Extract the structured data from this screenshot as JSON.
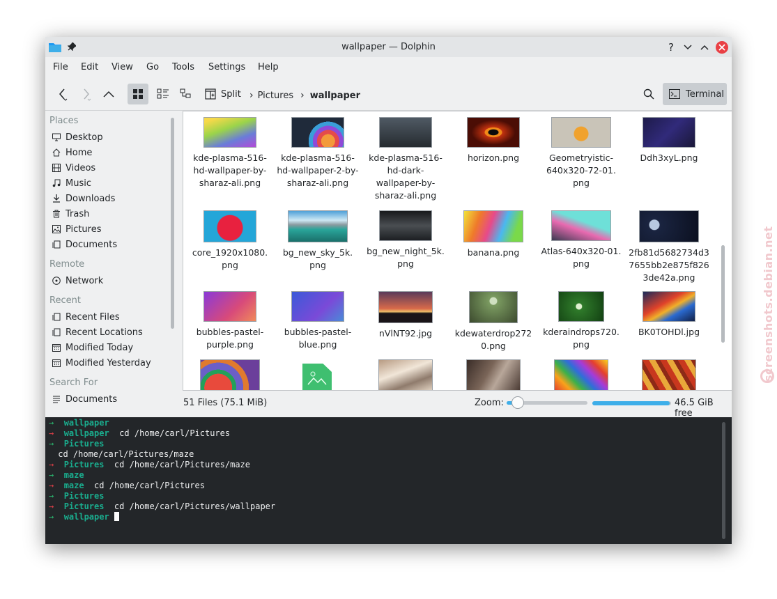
{
  "window": {
    "title": "wallpaper — Dolphin",
    "help_glyph": "?",
    "minimize_glyph": "⌄",
    "maximize_glyph": "⌃",
    "close_glyph": "✕"
  },
  "menubar": {
    "items": [
      "File",
      "Edit",
      "View",
      "Go",
      "Tools",
      "Settings",
      "Help"
    ]
  },
  "toolbar": {
    "split_label": "Split",
    "breadcrumb": [
      "Pictures",
      "wallpaper"
    ],
    "terminal_label": "Terminal"
  },
  "sidebar": {
    "sections": [
      {
        "title": "Places",
        "items": [
          {
            "label": "Desktop",
            "icon": "desktop-icon"
          },
          {
            "label": "Home",
            "icon": "home-icon"
          },
          {
            "label": "Videos",
            "icon": "videos-icon"
          },
          {
            "label": "Music",
            "icon": "music-icon"
          },
          {
            "label": "Downloads",
            "icon": "downloads-icon"
          },
          {
            "label": "Trash",
            "icon": "trash-icon"
          },
          {
            "label": "Pictures",
            "icon": "pictures-icon"
          },
          {
            "label": "Documents",
            "icon": "documents-icon"
          }
        ]
      },
      {
        "title": "Remote",
        "items": [
          {
            "label": "Network",
            "icon": "network-icon"
          }
        ]
      },
      {
        "title": "Recent",
        "items": [
          {
            "label": "Recent Files",
            "icon": "recent-files-icon"
          },
          {
            "label": "Recent Locations",
            "icon": "recent-locations-icon"
          },
          {
            "label": "Modified Today",
            "icon": "calendar-icon"
          },
          {
            "label": "Modified Yesterday",
            "icon": "calendar-icon"
          }
        ]
      },
      {
        "title": "Search For",
        "items": [
          {
            "label": "Documents",
            "icon": "documents-search-icon"
          }
        ]
      }
    ]
  },
  "files": [
    {
      "lines": [
        "kde-plasma-516-",
        "hd-wallpaper-by-",
        "sharaz-ali.png"
      ]
    },
    {
      "lines": [
        "kde-plasma-516-",
        "hd-wallpaper-2-by-",
        "sharaz-ali.png"
      ]
    },
    {
      "lines": [
        "kde-plasma-516-",
        "hd-dark-",
        "wallpaper-by-",
        "sharaz-ali.png"
      ]
    },
    {
      "lines": [
        "horizon.png"
      ]
    },
    {
      "lines": [
        "Geometryistic-",
        "640x320-72-01.",
        "png"
      ]
    },
    {
      "lines": [
        "Ddh3xyL.png"
      ]
    },
    {
      "lines": [
        "core_1920x1080.",
        "png"
      ]
    },
    {
      "lines": [
        "bg_new_sky_5k.",
        "png"
      ]
    },
    {
      "lines": [
        "bg_new_night_5k.",
        "png"
      ]
    },
    {
      "lines": [
        "banana.png"
      ]
    },
    {
      "lines": [
        "Atlas-640x320-01.",
        "png"
      ]
    },
    {
      "lines": [
        "2fb81d5682734d3",
        "7655bb2e875f826",
        "3de42a.png"
      ]
    },
    {
      "lines": [
        "bubbles-pastel-",
        "purple.png"
      ]
    },
    {
      "lines": [
        "bubbles-pastel-",
        "blue.png"
      ]
    },
    {
      "lines": [
        "nVlNT92.jpg"
      ]
    },
    {
      "lines": [
        "kdewaterdrop272",
        "0.png"
      ]
    },
    {
      "lines": [
        "kderaindrops720.",
        "png"
      ]
    },
    {
      "lines": [
        "BK0TOHDl.jpg"
      ]
    }
  ],
  "status": {
    "file_count": "51 Files (75.1 MiB)",
    "zoom_label": "Zoom:",
    "zoom_level": 0.14,
    "free_space": "46.5 GiB free",
    "disk_used_fraction": 0.98
  },
  "terminal": {
    "lines": [
      {
        "kind": "prompt",
        "arrow": "→",
        "dir": "wallpaper",
        "cmd": ""
      },
      {
        "kind": "prompt_err",
        "arrow": "→",
        "dir": "wallpaper",
        "cmd": "  cd /home/carl/Pictures"
      },
      {
        "kind": "prompt",
        "arrow": "→",
        "dir": "Pictures",
        "cmd": ""
      },
      {
        "kind": "plain",
        "text": " cd /home/carl/Pictures/maze"
      },
      {
        "kind": "prompt_err",
        "arrow": "→",
        "dir": "Pictures",
        "cmd": "  cd /home/carl/Pictures/maze"
      },
      {
        "kind": "prompt",
        "arrow": "→",
        "dir": "maze",
        "cmd": ""
      },
      {
        "kind": "prompt_err",
        "arrow": "→",
        "dir": "maze",
        "cmd": "  cd /home/carl/Pictures"
      },
      {
        "kind": "prompt",
        "arrow": "→",
        "dir": "Pictures",
        "cmd": ""
      },
      {
        "kind": "prompt_err",
        "arrow": "→",
        "dir": "Pictures",
        "cmd": "  cd /home/carl/Pictures/wallpaper"
      },
      {
        "kind": "prompt_cursor",
        "arrow": "→",
        "dir": "wallpaper",
        "cmd": ""
      }
    ]
  },
  "watermark": "screenshots.debian.net"
}
